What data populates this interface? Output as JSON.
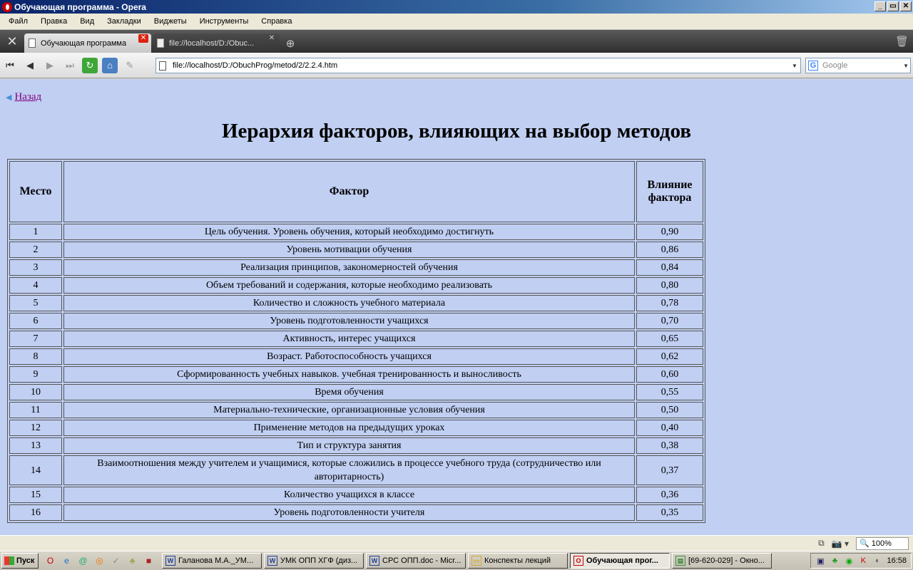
{
  "window": {
    "title": "Обучающая программа - Opera",
    "buttons": [
      "_",
      "▭",
      "✕"
    ]
  },
  "menu": [
    "Файл",
    "Правка",
    "Вид",
    "Закладки",
    "Виджеты",
    "Инструменты",
    "Справка"
  ],
  "tabs": [
    {
      "label": "Обучающая программа",
      "active": true
    },
    {
      "label": "file://localhost/D:/Obuc...",
      "active": false
    }
  ],
  "address": {
    "url": "file://localhost/D:/ObuchProg/metod/2/2.2.4.htm",
    "search_placeholder": "Google"
  },
  "page": {
    "back_label": "Назад",
    "title": "Иерархия факторов, влияющих на выбор методов",
    "table": {
      "headers": [
        "Место",
        "Фактор",
        "Влияние фактора"
      ],
      "rows": [
        [
          "1",
          "Цель обучения. Уровень обучения, который необходимо достигнуть",
          "0,90"
        ],
        [
          "2",
          "Уровень мотивации обучения",
          "0,86"
        ],
        [
          "3",
          "Реализация принципов, закономерностей обучения",
          "0,84"
        ],
        [
          "4",
          "Объем требований и содержания, которые необходимо реализовать",
          "0,80"
        ],
        [
          "5",
          "Количество и сложность учебного материала",
          "0,78"
        ],
        [
          "6",
          "Уровень подготовленности учащихся",
          "0,70"
        ],
        [
          "7",
          "Активность, интерес учащихся",
          "0,65"
        ],
        [
          "8",
          "Возраст. Работоспособность учащихся",
          "0,62"
        ],
        [
          "9",
          "Сформированность учебных навыков. учебная тренированность и выносливость",
          "0,60"
        ],
        [
          "10",
          "Время обучения",
          "0,55"
        ],
        [
          "11",
          "Материально-технические, организационные условия обучения",
          "0,50"
        ],
        [
          "12",
          "Применение методов на предыдущих уроках",
          "0,40"
        ],
        [
          "13",
          "Тип и структура занятия",
          "0,38"
        ],
        [
          "14",
          "Взаимоотношения между учителем и учащимися, которые сложились в процессе учебного труда (сотрудничество или авторитарность)",
          "0,37"
        ],
        [
          "15",
          "Количество учащихся в классе",
          "0,36"
        ],
        [
          "16",
          "Уровень подготовленности учителя",
          "0,35"
        ]
      ]
    }
  },
  "status": {
    "zoom": "100%"
  },
  "taskbar": {
    "start_label": "Пуск",
    "tasks": [
      {
        "label": "Галанова М.А._УМ...",
        "icon": "word-icon",
        "active": false
      },
      {
        "label": "УМК ОПП ХГФ (диз...",
        "icon": "word-icon",
        "active": false
      },
      {
        "label": "СРС ОПП.doc - Micr...",
        "icon": "word-icon",
        "active": false
      },
      {
        "label": "Конспекты лекций",
        "icon": "folder-icon",
        "active": false
      },
      {
        "label": "Обучающая прог...",
        "icon": "opera-icon",
        "active": true
      },
      {
        "label": "[69-620-029] - Окно...",
        "icon": "app-icon",
        "active": false
      }
    ],
    "clock": "16:58"
  },
  "colors": {
    "page_background": "#c0cff2",
    "link_visited": "#800080",
    "active_tab_close": "#d21"
  }
}
